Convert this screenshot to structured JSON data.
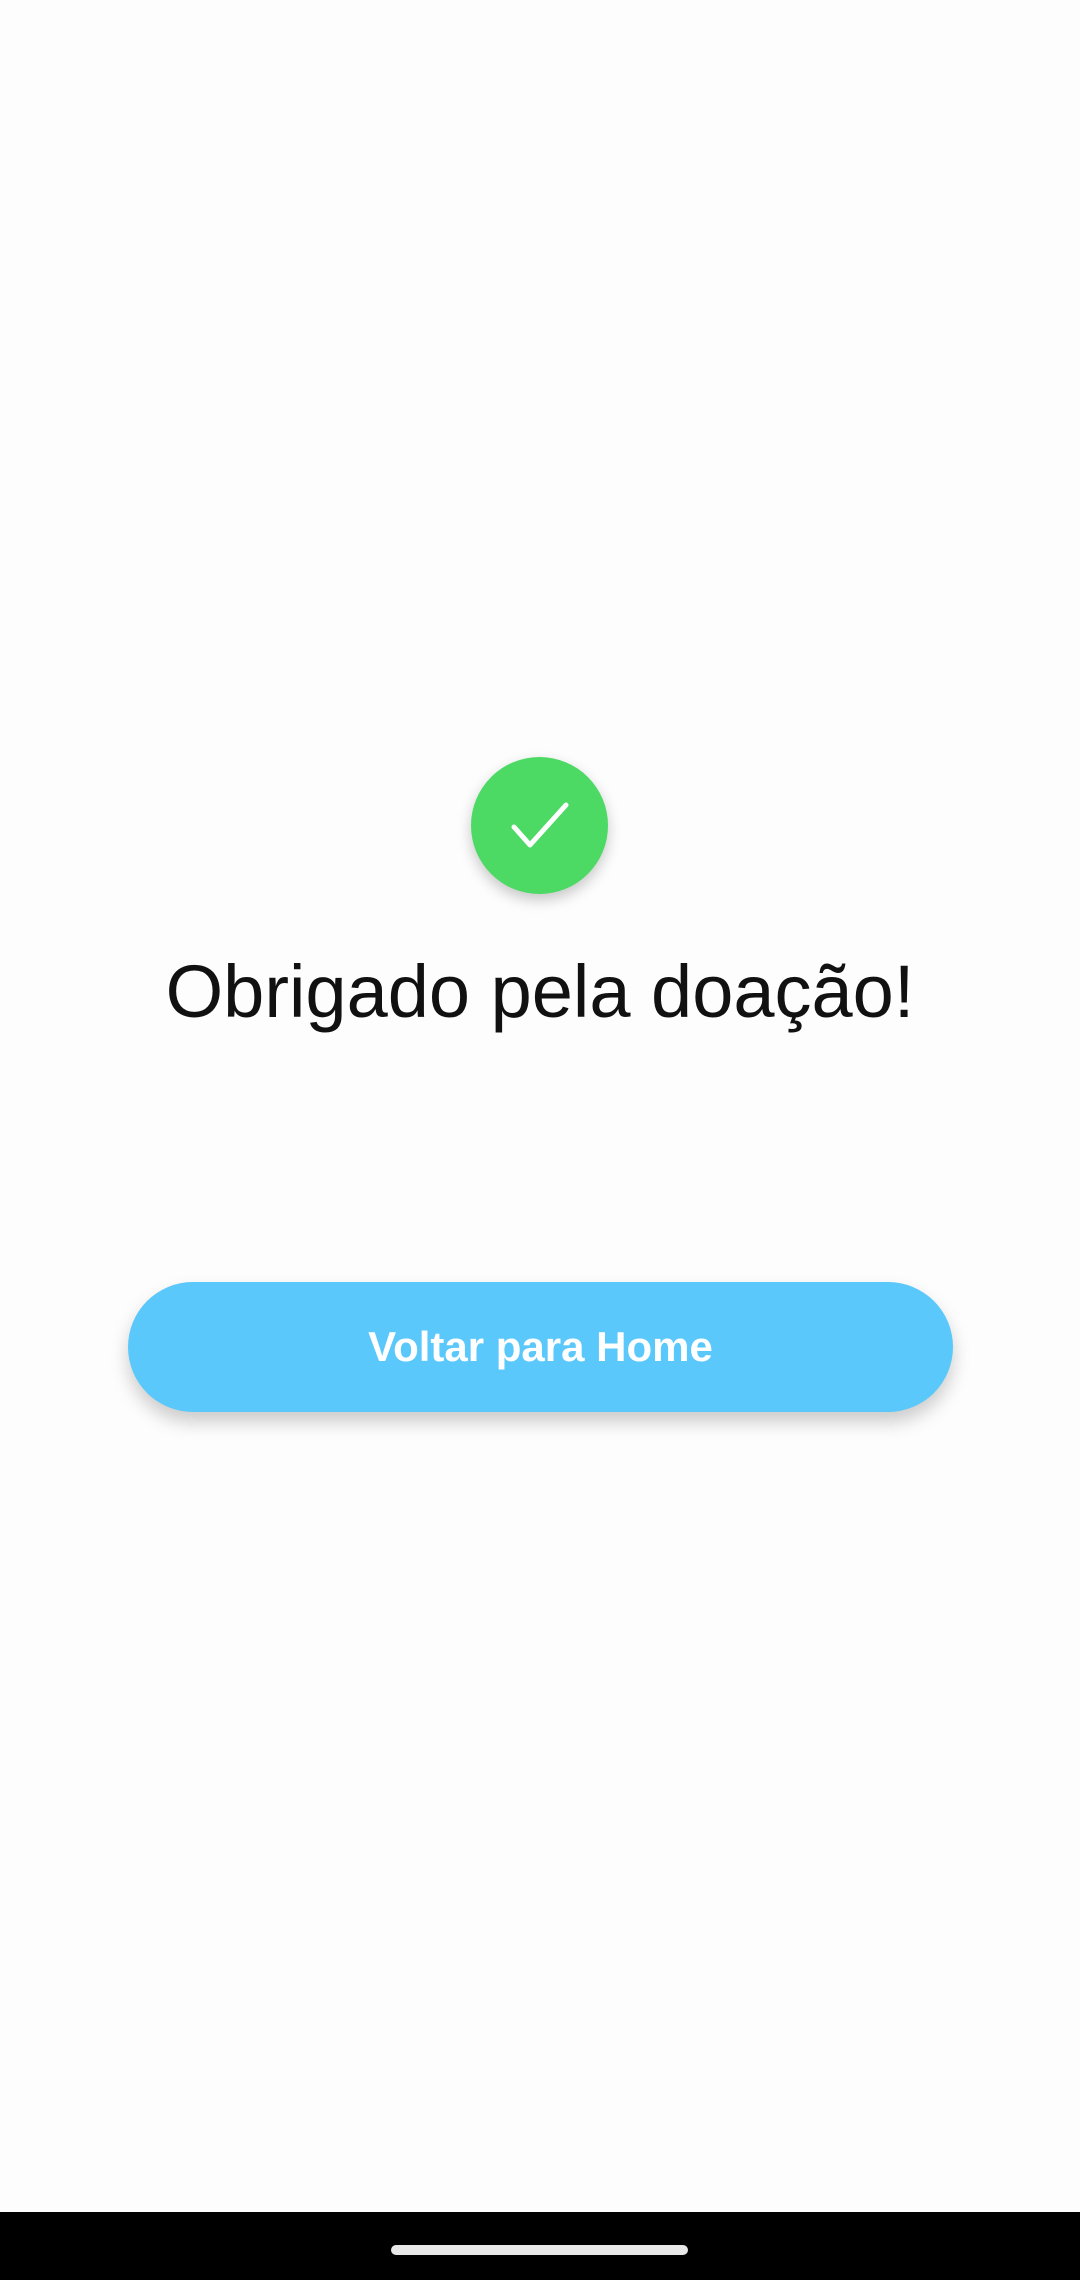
{
  "confirmation": {
    "title": "Obrigado pela doação!",
    "icon": "checkmark-icon",
    "badge_color": "#4cd964"
  },
  "actions": {
    "home_button_label": "Voltar para Home",
    "home_button_color": "#5ac8fa"
  },
  "system": {
    "nav_bar_color": "#000000"
  }
}
